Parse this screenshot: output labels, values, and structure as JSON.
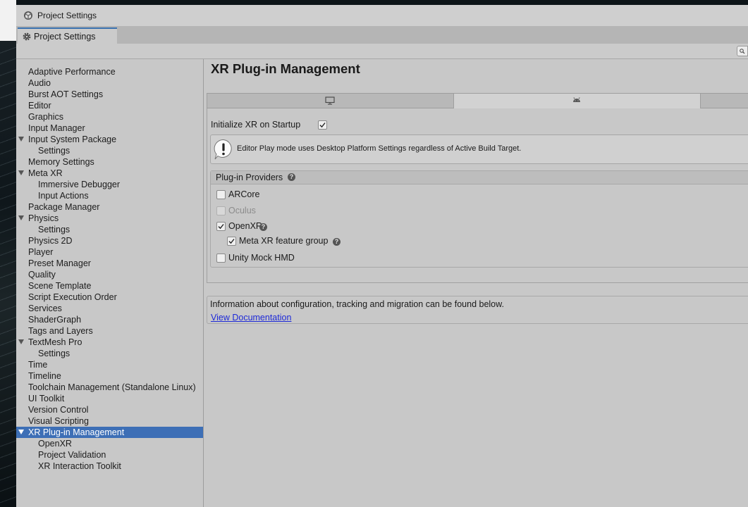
{
  "window": {
    "title": "Project Settings"
  },
  "tab": {
    "label": "Project Settings"
  },
  "sidebar": {
    "items": [
      {
        "label": "Adaptive Performance",
        "indent": 0
      },
      {
        "label": "Audio",
        "indent": 0
      },
      {
        "label": "Burst AOT Settings",
        "indent": 0
      },
      {
        "label": "Editor",
        "indent": 0
      },
      {
        "label": "Graphics",
        "indent": 0
      },
      {
        "label": "Input Manager",
        "indent": 0
      },
      {
        "label": "Input System Package",
        "indent": 0,
        "expanded": true
      },
      {
        "label": "Settings",
        "indent": 1
      },
      {
        "label": "Memory Settings",
        "indent": 0
      },
      {
        "label": "Meta XR",
        "indent": 0,
        "expanded": true
      },
      {
        "label": "Immersive Debugger",
        "indent": 1
      },
      {
        "label": "Input Actions",
        "indent": 1
      },
      {
        "label": "Package Manager",
        "indent": 0
      },
      {
        "label": "Physics",
        "indent": 0,
        "expanded": true
      },
      {
        "label": "Settings",
        "indent": 1
      },
      {
        "label": "Physics 2D",
        "indent": 0
      },
      {
        "label": "Player",
        "indent": 0
      },
      {
        "label": "Preset Manager",
        "indent": 0
      },
      {
        "label": "Quality",
        "indent": 0
      },
      {
        "label": "Scene Template",
        "indent": 0
      },
      {
        "label": "Script Execution Order",
        "indent": 0
      },
      {
        "label": "Services",
        "indent": 0
      },
      {
        "label": "ShaderGraph",
        "indent": 0
      },
      {
        "label": "Tags and Layers",
        "indent": 0
      },
      {
        "label": "TextMesh Pro",
        "indent": 0,
        "expanded": true
      },
      {
        "label": "Settings",
        "indent": 1
      },
      {
        "label": "Time",
        "indent": 0
      },
      {
        "label": "Timeline",
        "indent": 0
      },
      {
        "label": "Toolchain Management (Standalone Linux)",
        "indent": 0
      },
      {
        "label": "UI Toolkit",
        "indent": 0
      },
      {
        "label": "Version Control",
        "indent": 0
      },
      {
        "label": "Visual Scripting",
        "indent": 0
      },
      {
        "label": "XR Plug-in Management",
        "indent": 0,
        "expanded": true,
        "selected": true
      },
      {
        "label": "OpenXR",
        "indent": 1
      },
      {
        "label": "Project Validation",
        "indent": 1
      },
      {
        "label": "XR Interaction Toolkit",
        "indent": 1
      }
    ]
  },
  "main": {
    "title": "XR Plug-in Management",
    "platform_tabs": [
      {
        "icon": "desktop-icon",
        "active": false
      },
      {
        "icon": "android-icon",
        "active": true
      },
      {
        "icon": "",
        "active": false
      }
    ],
    "init_label": "Initialize XR on Startup",
    "init_checked": true,
    "help_message": "Editor Play mode uses Desktop Platform Settings regardless of Active Build Target.",
    "providers_title": "Plug-in Providers",
    "providers": [
      {
        "label": "ARCore",
        "checked": false,
        "disabled": false
      },
      {
        "label": "Oculus",
        "checked": false,
        "disabled": true
      },
      {
        "label": "OpenXR",
        "checked": true,
        "disabled": false,
        "help": true
      },
      {
        "label": "Meta XR feature group",
        "checked": true,
        "disabled": false,
        "help": true,
        "sub": true
      },
      {
        "label": "Unity Mock HMD",
        "checked": false,
        "disabled": false
      }
    ],
    "info_text": "Information about configuration, tracking and migration can be found below.",
    "doc_link": "View Documentation"
  }
}
